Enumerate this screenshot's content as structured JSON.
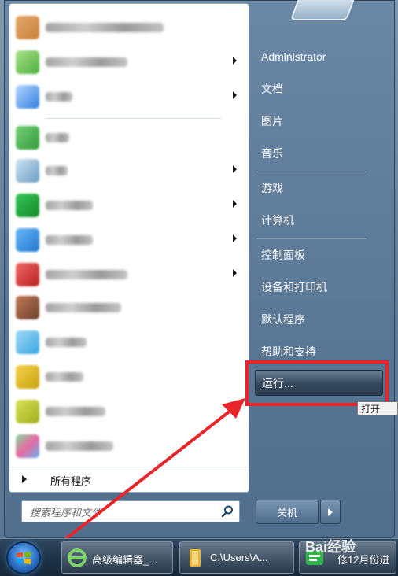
{
  "left": {
    "all_programs": "所有程序",
    "search_placeholder": "搜索程序和文件"
  },
  "right": {
    "user": "Administrator",
    "documents": "文档",
    "pictures": "图片",
    "music": "音乐",
    "games": "游戏",
    "computer": "计算机",
    "control_panel": "控制面板",
    "devices_printers": "设备和打印机",
    "default_programs": "默认程序",
    "help_support": "帮助和支持",
    "run": "运行...",
    "run_tooltip": "打开",
    "shutdown": "关机"
  },
  "taskbar": {
    "item1": "高级编辑器_...",
    "item2": "C:\\Users\\A...",
    "item3": "修12月份进",
    "watermark": "Bai经验"
  },
  "colors": {
    "highlight_red": "#e8252b",
    "menu_blue": "#5f7d9b"
  }
}
